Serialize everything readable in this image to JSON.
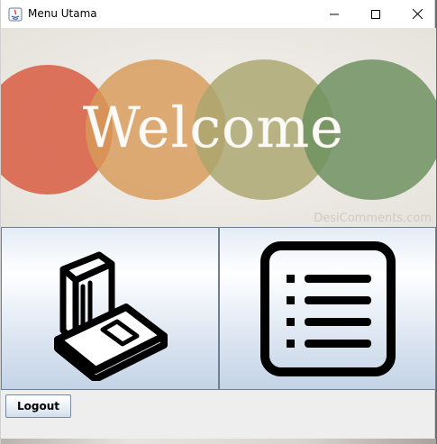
{
  "window": {
    "title": "Menu Utama",
    "controls": {
      "minimize": "minimize-icon",
      "maximize": "maximize-icon",
      "close": "close-icon"
    }
  },
  "banner": {
    "welcome_text": "Welcome",
    "watermark": "DesiComments.com",
    "circle_colors": [
      "#d9644a",
      "#d89a58",
      "#a9a56d",
      "#6f9160"
    ]
  },
  "menu_buttons": [
    {
      "icon": "book-scanner-icon"
    },
    {
      "icon": "list-icon"
    }
  ],
  "logout": {
    "label": "Logout"
  }
}
